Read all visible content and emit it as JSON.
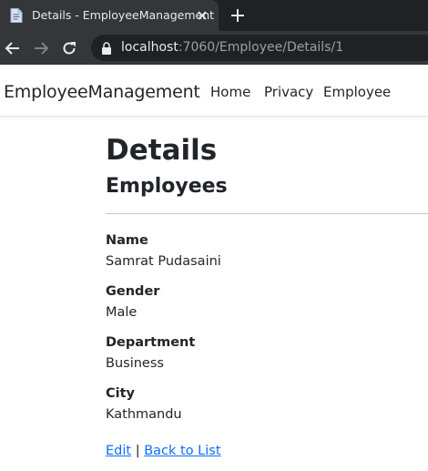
{
  "browser": {
    "tab_title": "Details - EmployeeManagement",
    "url_host": "localhost",
    "url_rest": ":7060/Employee/Details/1"
  },
  "navbar": {
    "brand": "EmployeeManagement",
    "links": [
      "Home",
      "Privacy",
      "Employee"
    ]
  },
  "page": {
    "title": "Details",
    "subtitle": "Employees",
    "fields": [
      {
        "label": "Name",
        "value": "Samrat Pudasaini"
      },
      {
        "label": "Gender",
        "value": "Male"
      },
      {
        "label": "Department",
        "value": "Business"
      },
      {
        "label": "City",
        "value": "Kathmandu"
      }
    ],
    "actions": {
      "edit": "Edit",
      "separator": "|",
      "back": "Back to List"
    }
  },
  "colors": {
    "link": "#0d6efd",
    "text": "#212529",
    "chrome_dark": "#202124",
    "chrome_tab": "#35363a"
  }
}
